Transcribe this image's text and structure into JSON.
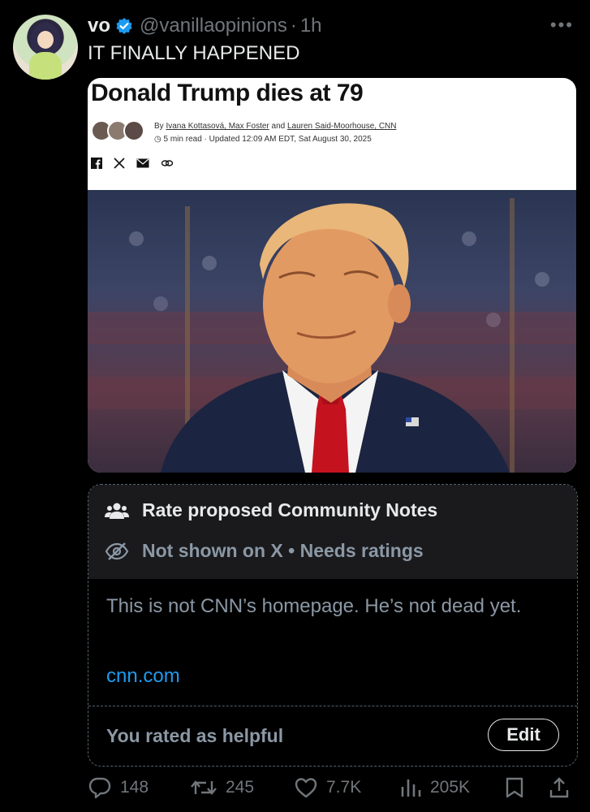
{
  "tweet": {
    "display_name": "vo",
    "handle": "@vanillaopinions",
    "separator": "·",
    "time": "1h",
    "text": "IT FINALLY HAPPENED"
  },
  "article": {
    "headline": "Donald Trump dies at 79",
    "byline_prefix": "By ",
    "byline_authors": "Ivana Kottasová, Max Foster",
    "byline_and": " and ",
    "byline_last": "Lauren Said-Moorhouse, CNN",
    "meta": "5 min read · Updated 12:09 AM EDT, Sat August 30, 2025",
    "share_icons": [
      "facebook-icon",
      "x-icon",
      "mail-icon",
      "link-icon"
    ]
  },
  "community_note": {
    "title": "Rate proposed Community Notes",
    "status": "Not shown on X • Needs ratings",
    "text": "This is not CNN’s homepage. He’s not dead yet.",
    "link": "cnn.com",
    "rating_status": "You rated as helpful",
    "edit_label": "Edit"
  },
  "actions": {
    "replies": "148",
    "reposts": "245",
    "likes": "7.7K",
    "views": "205K"
  },
  "colors": {
    "background": "#000000",
    "accent": "#1d9bf0",
    "muted": "#71767b",
    "note_header_bg": "#1a1a1d"
  }
}
